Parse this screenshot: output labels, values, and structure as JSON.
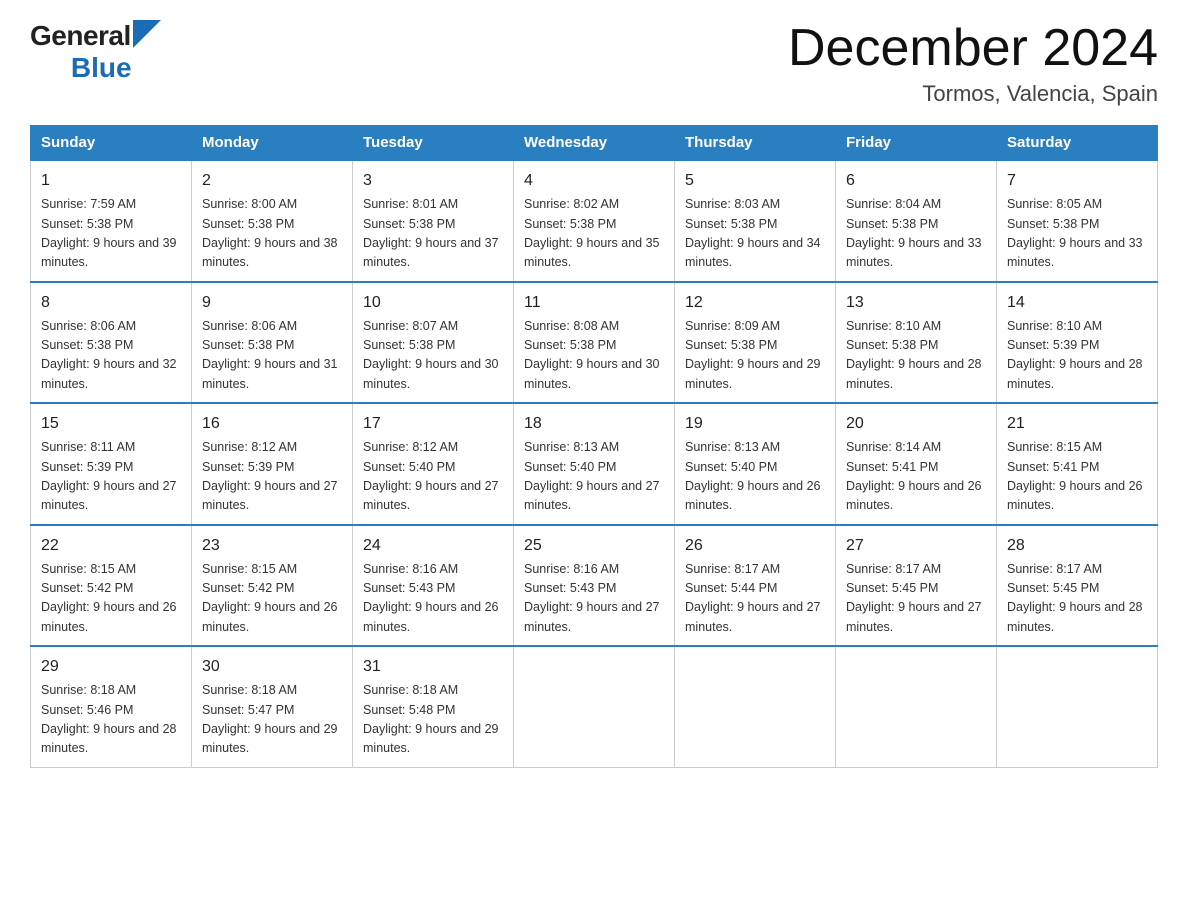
{
  "logo": {
    "general": "General",
    "blue": "Blue"
  },
  "title": "December 2024",
  "subtitle": "Tormos, Valencia, Spain",
  "days_header": [
    "Sunday",
    "Monday",
    "Tuesday",
    "Wednesday",
    "Thursday",
    "Friday",
    "Saturday"
  ],
  "weeks": [
    [
      {
        "day": 1,
        "sunrise": "7:59 AM",
        "sunset": "5:38 PM",
        "daylight": "9 hours and 39 minutes."
      },
      {
        "day": 2,
        "sunrise": "8:00 AM",
        "sunset": "5:38 PM",
        "daylight": "9 hours and 38 minutes."
      },
      {
        "day": 3,
        "sunrise": "8:01 AM",
        "sunset": "5:38 PM",
        "daylight": "9 hours and 37 minutes."
      },
      {
        "day": 4,
        "sunrise": "8:02 AM",
        "sunset": "5:38 PM",
        "daylight": "9 hours and 35 minutes."
      },
      {
        "day": 5,
        "sunrise": "8:03 AM",
        "sunset": "5:38 PM",
        "daylight": "9 hours and 34 minutes."
      },
      {
        "day": 6,
        "sunrise": "8:04 AM",
        "sunset": "5:38 PM",
        "daylight": "9 hours and 33 minutes."
      },
      {
        "day": 7,
        "sunrise": "8:05 AM",
        "sunset": "5:38 PM",
        "daylight": "9 hours and 33 minutes."
      }
    ],
    [
      {
        "day": 8,
        "sunrise": "8:06 AM",
        "sunset": "5:38 PM",
        "daylight": "9 hours and 32 minutes."
      },
      {
        "day": 9,
        "sunrise": "8:06 AM",
        "sunset": "5:38 PM",
        "daylight": "9 hours and 31 minutes."
      },
      {
        "day": 10,
        "sunrise": "8:07 AM",
        "sunset": "5:38 PM",
        "daylight": "9 hours and 30 minutes."
      },
      {
        "day": 11,
        "sunrise": "8:08 AM",
        "sunset": "5:38 PM",
        "daylight": "9 hours and 30 minutes."
      },
      {
        "day": 12,
        "sunrise": "8:09 AM",
        "sunset": "5:38 PM",
        "daylight": "9 hours and 29 minutes."
      },
      {
        "day": 13,
        "sunrise": "8:10 AM",
        "sunset": "5:38 PM",
        "daylight": "9 hours and 28 minutes."
      },
      {
        "day": 14,
        "sunrise": "8:10 AM",
        "sunset": "5:39 PM",
        "daylight": "9 hours and 28 minutes."
      }
    ],
    [
      {
        "day": 15,
        "sunrise": "8:11 AM",
        "sunset": "5:39 PM",
        "daylight": "9 hours and 27 minutes."
      },
      {
        "day": 16,
        "sunrise": "8:12 AM",
        "sunset": "5:39 PM",
        "daylight": "9 hours and 27 minutes."
      },
      {
        "day": 17,
        "sunrise": "8:12 AM",
        "sunset": "5:40 PM",
        "daylight": "9 hours and 27 minutes."
      },
      {
        "day": 18,
        "sunrise": "8:13 AM",
        "sunset": "5:40 PM",
        "daylight": "9 hours and 27 minutes."
      },
      {
        "day": 19,
        "sunrise": "8:13 AM",
        "sunset": "5:40 PM",
        "daylight": "9 hours and 26 minutes."
      },
      {
        "day": 20,
        "sunrise": "8:14 AM",
        "sunset": "5:41 PM",
        "daylight": "9 hours and 26 minutes."
      },
      {
        "day": 21,
        "sunrise": "8:15 AM",
        "sunset": "5:41 PM",
        "daylight": "9 hours and 26 minutes."
      }
    ],
    [
      {
        "day": 22,
        "sunrise": "8:15 AM",
        "sunset": "5:42 PM",
        "daylight": "9 hours and 26 minutes."
      },
      {
        "day": 23,
        "sunrise": "8:15 AM",
        "sunset": "5:42 PM",
        "daylight": "9 hours and 26 minutes."
      },
      {
        "day": 24,
        "sunrise": "8:16 AM",
        "sunset": "5:43 PM",
        "daylight": "9 hours and 26 minutes."
      },
      {
        "day": 25,
        "sunrise": "8:16 AM",
        "sunset": "5:43 PM",
        "daylight": "9 hours and 27 minutes."
      },
      {
        "day": 26,
        "sunrise": "8:17 AM",
        "sunset": "5:44 PM",
        "daylight": "9 hours and 27 minutes."
      },
      {
        "day": 27,
        "sunrise": "8:17 AM",
        "sunset": "5:45 PM",
        "daylight": "9 hours and 27 minutes."
      },
      {
        "day": 28,
        "sunrise": "8:17 AM",
        "sunset": "5:45 PM",
        "daylight": "9 hours and 28 minutes."
      }
    ],
    [
      {
        "day": 29,
        "sunrise": "8:18 AM",
        "sunset": "5:46 PM",
        "daylight": "9 hours and 28 minutes."
      },
      {
        "day": 30,
        "sunrise": "8:18 AM",
        "sunset": "5:47 PM",
        "daylight": "9 hours and 29 minutes."
      },
      {
        "day": 31,
        "sunrise": "8:18 AM",
        "sunset": "5:48 PM",
        "daylight": "9 hours and 29 minutes."
      },
      null,
      null,
      null,
      null
    ]
  ]
}
